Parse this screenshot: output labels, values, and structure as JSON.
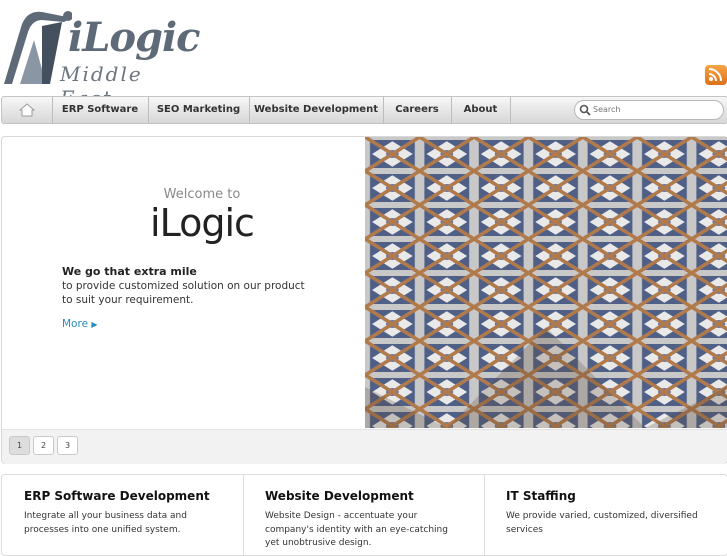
{
  "brand": {
    "name": "iLogic",
    "subtitle": "Middle East"
  },
  "nav": {
    "items": [
      {
        "label": "ERP Software"
      },
      {
        "label": "SEO Marketing"
      },
      {
        "label": "Website Development"
      },
      {
        "label": "Careers"
      },
      {
        "label": "About"
      }
    ],
    "search_placeholder": "Search"
  },
  "slide": {
    "welcome": "Welcome to",
    "brand": "iLogic",
    "tagline": "We go that extra mile",
    "text": "to provide customized solution on our product to suit your requirement.",
    "more": "More"
  },
  "pager": {
    "pages": [
      "1",
      "2",
      "3"
    ],
    "active": "1"
  },
  "features": [
    {
      "title": "ERP Software Development",
      "text": "Integrate all your business data and processes into one unified system."
    },
    {
      "title": "Website Development",
      "text": "Website Design - accentuate your company's identity with an eye-catching yet unobtrusive design."
    },
    {
      "title": "IT Staffing",
      "text": "We provide varied, customized, diversified services"
    }
  ],
  "colors": {
    "accent_link": "#2a8bc0",
    "rss": "#f08a2c",
    "logo": "#5e6a78"
  }
}
